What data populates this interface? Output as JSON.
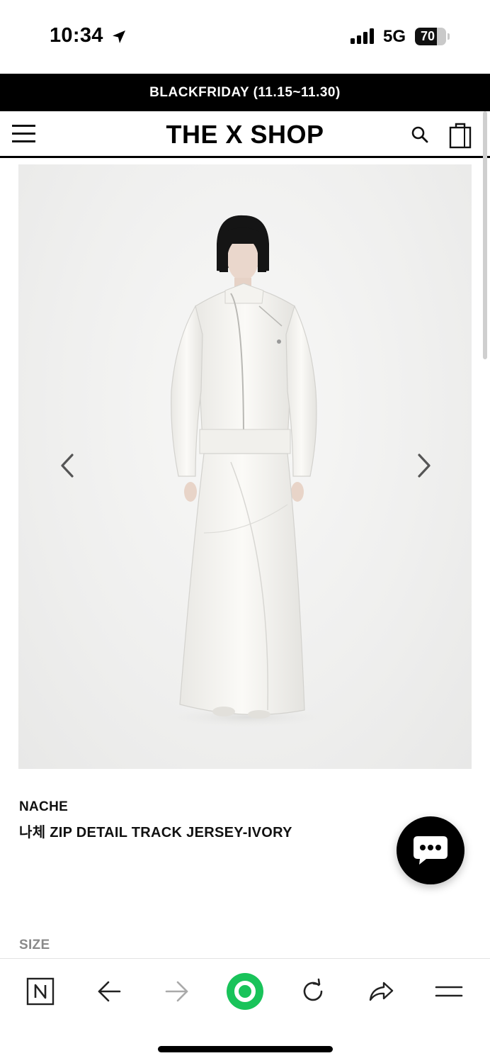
{
  "status_bar": {
    "time": "10:34",
    "network": "5G",
    "battery": "70",
    "battery_level": 0.7
  },
  "promo_banner": {
    "text": "BLACKFRIDAY (11.15~11.30)"
  },
  "header": {
    "logo": "THE X SHOP"
  },
  "product": {
    "brand": "NACHE",
    "title": "나체 ZIP DETAIL TRACK JERSEY-IVORY",
    "size_label": "SIZE"
  },
  "colors": {
    "accent_green": "#19c35a",
    "banner_bg": "#000000"
  }
}
